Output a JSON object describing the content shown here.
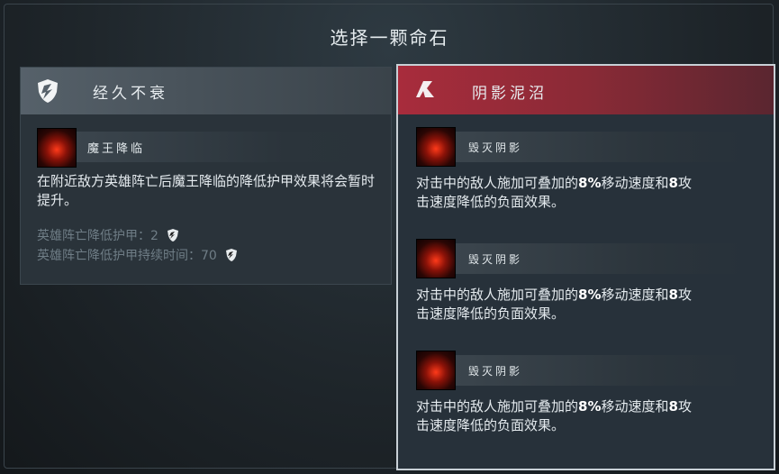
{
  "title": "选择一颗命石",
  "left_card": {
    "name": "经久不衰",
    "ability": {
      "name": "魔王降临",
      "description": "在附近敌方英雄阵亡后魔王降临的降低护甲效果将会暂时提升。",
      "stats": [
        {
          "label": "英雄阵亡降低护甲：",
          "value": "2"
        },
        {
          "label": "英雄阵亡降低护甲持续时间：",
          "value": "70"
        }
      ]
    }
  },
  "right_card": {
    "name": "阴影泥沼",
    "selected": true,
    "abilities": [
      {
        "name": "毁灭阴影",
        "desc_a": "对击中的敌人施加可叠加的",
        "pct": "8%",
        "desc_b": "移动速度和",
        "num": "8",
        "desc_c": "攻",
        "desc_d": "击速度降低的负面效果。"
      },
      {
        "name": "毁灭阴影",
        "desc_a": "对击中的敌人施加可叠加的",
        "pct": "8%",
        "desc_b": "移动速度和",
        "num": "8",
        "desc_c": "攻",
        "desc_d": "击速度降低的负面效果。"
      },
      {
        "name": "毁灭阴影",
        "desc_a": "对击中的敌人施加可叠加的",
        "pct": "8%",
        "desc_b": "移动速度和",
        "num": "8",
        "desc_c": "攻",
        "desc_d": "击速度降低的负面效果。"
      }
    ]
  },
  "colors": {
    "left_header": "#56616a",
    "right_header": "#a82c3c",
    "selected_border": "#c8d0d6"
  }
}
